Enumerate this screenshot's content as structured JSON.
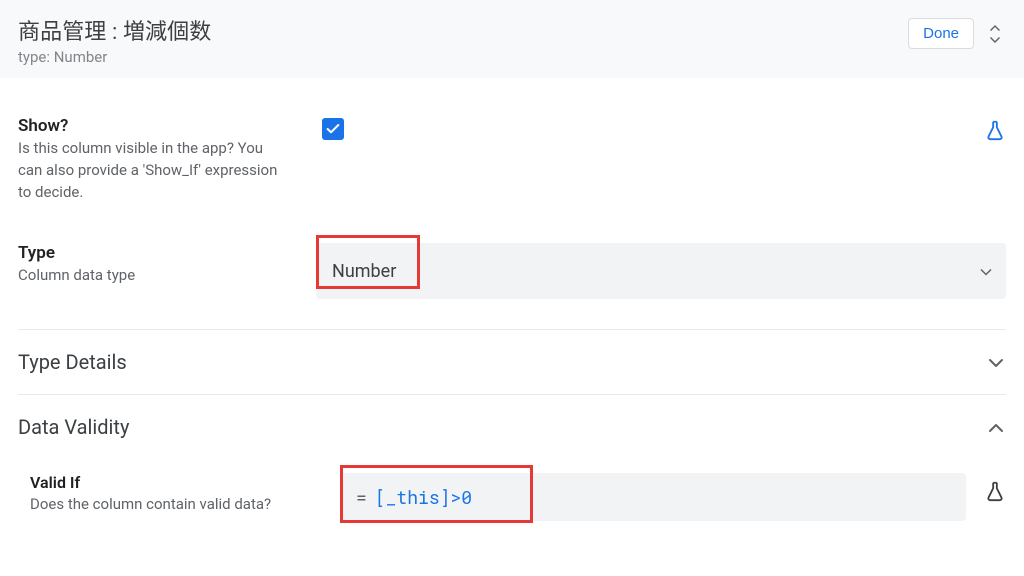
{
  "header": {
    "title": "商品管理 : 増減個数",
    "subtitle": "type: Number",
    "done_label": "Done"
  },
  "show": {
    "title": "Show?",
    "desc": "Is this column visible in the app? You can also provide a 'Show_If' expression to decide.",
    "checked": true
  },
  "type": {
    "title": "Type",
    "desc": "Column data type",
    "value": "Number"
  },
  "sections": {
    "type_details": "Type Details",
    "data_validity": "Data Validity"
  },
  "valid_if": {
    "title": "Valid If",
    "desc": "Does the column contain valid data?",
    "expr_prefix": "=",
    "expr_col": "[_this]",
    "expr_rest": ">0"
  },
  "colors": {
    "accent": "#1a73e8",
    "highlight_border": "#e53935"
  }
}
